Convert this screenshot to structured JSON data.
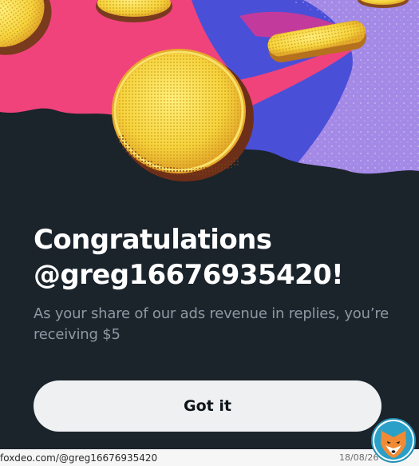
{
  "dialog": {
    "title_line1": "Congratulations",
    "title_line2": "@greg16676935420!",
    "message": "As your share of our ads revenue in replies, you’re receiving $5",
    "button_label": "Got it"
  },
  "watermark": {
    "site_text": "foxdeo.com/@greg16676935420",
    "date": "18/08/26",
    "logo_icon": "fox-icon"
  },
  "colors": {
    "background": "#1b232b",
    "title": "#ffffff",
    "message": "#8e98a3",
    "button_bg": "#eef0f2",
    "button_text": "#0f1419",
    "hero_pink": "#f0437c",
    "hero_blue": "#4a4fd8",
    "hero_lavender": "#a48ae6",
    "coin_yellow": "#f5dd4c"
  }
}
